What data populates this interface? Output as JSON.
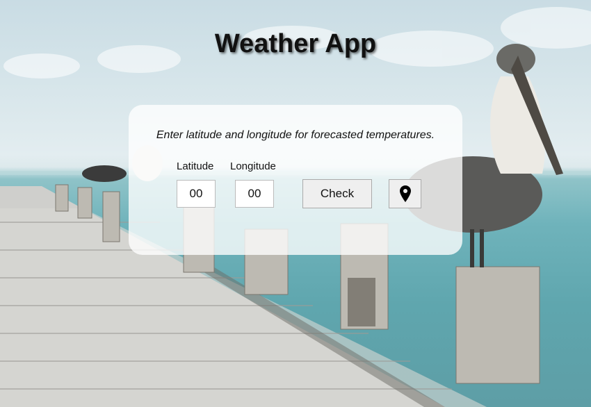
{
  "header": {
    "title": "Weather App"
  },
  "card": {
    "prompt": "Enter latitude and longitude for forecasted temperatures.",
    "latitude": {
      "label": "Latitude",
      "value": "00"
    },
    "longitude": {
      "label": "Longitude",
      "value": "00"
    },
    "check_label": "Check",
    "location_icon": "map-marker-icon"
  },
  "colors": {
    "card_background": "#ffffff",
    "button_background": "#efefef",
    "title_text": "#111111"
  }
}
